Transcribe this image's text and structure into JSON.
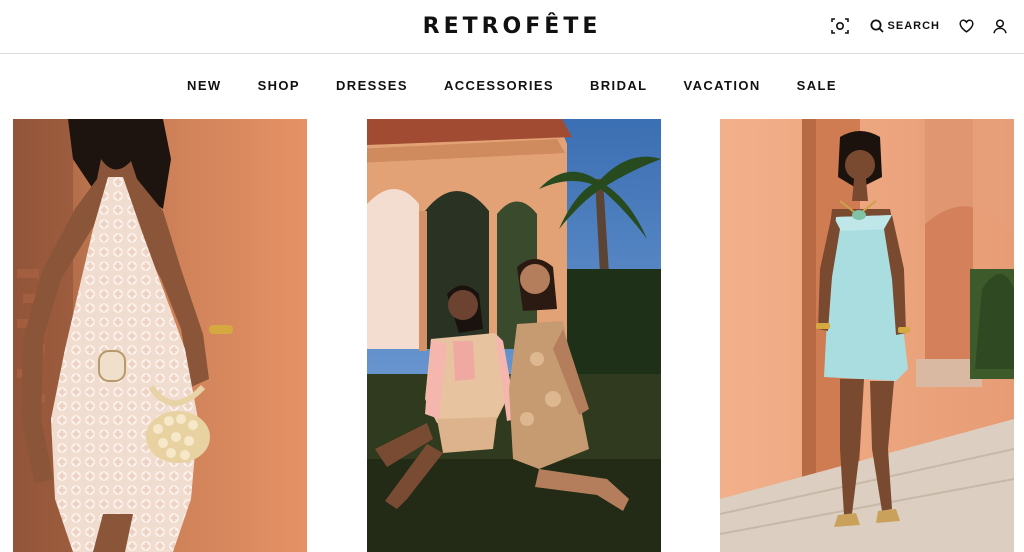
{
  "header": {
    "logo": "RETROFÊTE",
    "search_label": "SEARCH",
    "icons": [
      "camera-scan-icon",
      "search-icon",
      "heart-icon",
      "user-icon"
    ]
  },
  "nav": {
    "items": [
      {
        "label": "NEW"
      },
      {
        "label": "SHOP"
      },
      {
        "label": "DRESSES"
      },
      {
        "label": "ACCESSORIES"
      },
      {
        "label": "BRIDAL"
      },
      {
        "label": "VACATION"
      },
      {
        "label": "SALE"
      }
    ]
  },
  "colors": {
    "text": "#111111",
    "divider": "#dcdcdc",
    "terracotta": "#d9885f",
    "peach": "#f1b593",
    "mint": "#a9dde0",
    "foliage": "#2c3b21"
  }
}
